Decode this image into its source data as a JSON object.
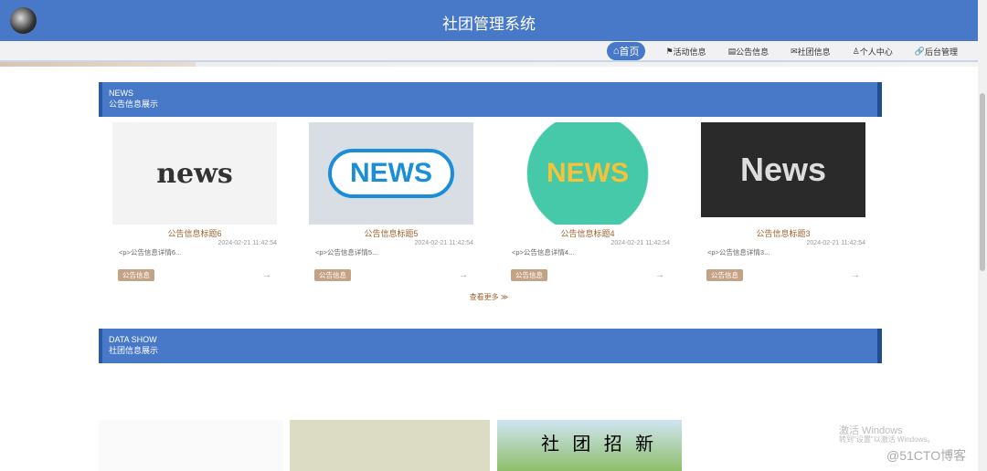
{
  "header": {
    "title": "社团管理系统"
  },
  "nav": [
    {
      "label": "首页",
      "icon": "home-icon"
    },
    {
      "label": "活动信息",
      "icon": "activity-icon"
    },
    {
      "label": "公告信息",
      "icon": "notice-icon"
    },
    {
      "label": "社团信息",
      "icon": "mail-icon"
    },
    {
      "label": "个人中心",
      "icon": "user-icon"
    },
    {
      "label": "后台管理",
      "icon": "link-icon"
    }
  ],
  "news": {
    "en": "NEWS",
    "zh": "公告信息展示",
    "more": "查看更多 ≫",
    "cards": [
      {
        "img": "news",
        "title": "公告信息标题6",
        "date": "2024-02-21 11:42:54",
        "desc": "<p>公告信息详情6...",
        "tag": "公告信息"
      },
      {
        "img": "NEWS",
        "title": "公告信息标题5",
        "date": "2024-02-21 11:42:54",
        "desc": "<p>公告信息详情5...",
        "tag": "公告信息"
      },
      {
        "img": "NEWS",
        "title": "公告信息标题4",
        "date": "2024-02-21 11:42:54",
        "desc": "<p>公告信息详情4...",
        "tag": "公告信息"
      },
      {
        "img": "News",
        "title": "公告信息标题3",
        "date": "2024-02-21 11:42:54",
        "desc": "<p>公告信息详情3...",
        "tag": "公告信息"
      }
    ]
  },
  "data_show": {
    "en": "DATA SHOW",
    "zh": "社团信息展示",
    "third_img_text": "社 团 招 新"
  },
  "watermark": {
    "line1": "激活 Windows",
    "line2": "转到\"设置\"以激活 Windows。",
    "brand": "@51CTO博客"
  }
}
